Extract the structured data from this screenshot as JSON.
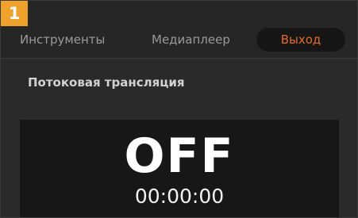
{
  "step_badge": "1",
  "tabs": [
    {
      "label": "Инструменты",
      "active": false
    },
    {
      "label": "Медиаплеер",
      "active": false
    },
    {
      "label": "Выход",
      "active": true
    }
  ],
  "section": {
    "title": "Потоковая трансляция"
  },
  "stream_status": {
    "value": "OFF",
    "timecode": "00:00:00"
  },
  "colors": {
    "badge": "#f0a12b",
    "active_tab_text": "#e36a2a",
    "background": "#2a2a2a",
    "panel": "#171717"
  }
}
